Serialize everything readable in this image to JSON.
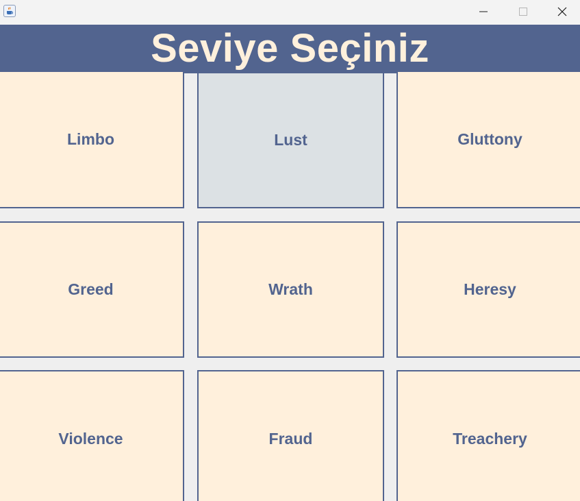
{
  "window": {
    "icon": "java-cup-icon",
    "controls": {
      "minimize": "minimize-icon",
      "maximize": "maximize-icon",
      "close": "close-icon"
    }
  },
  "header": {
    "title": "Seviye Seçiniz"
  },
  "levels": [
    {
      "label": "Limbo"
    },
    {
      "label": "Lust",
      "state": "hovered"
    },
    {
      "label": "Gluttony"
    },
    {
      "label": "Greed"
    },
    {
      "label": "Wrath"
    },
    {
      "label": "Heresy"
    },
    {
      "label": "Violence"
    },
    {
      "label": "Fraud"
    },
    {
      "label": "Treachery"
    }
  ],
  "colors": {
    "header_bg": "#52648f",
    "header_text": "#fff0dc",
    "button_bg": "#fff0dc",
    "button_hover_bg": "#dce1e4",
    "button_text": "#52648f",
    "button_border": "#52648f",
    "window_bg": "#efefef"
  }
}
